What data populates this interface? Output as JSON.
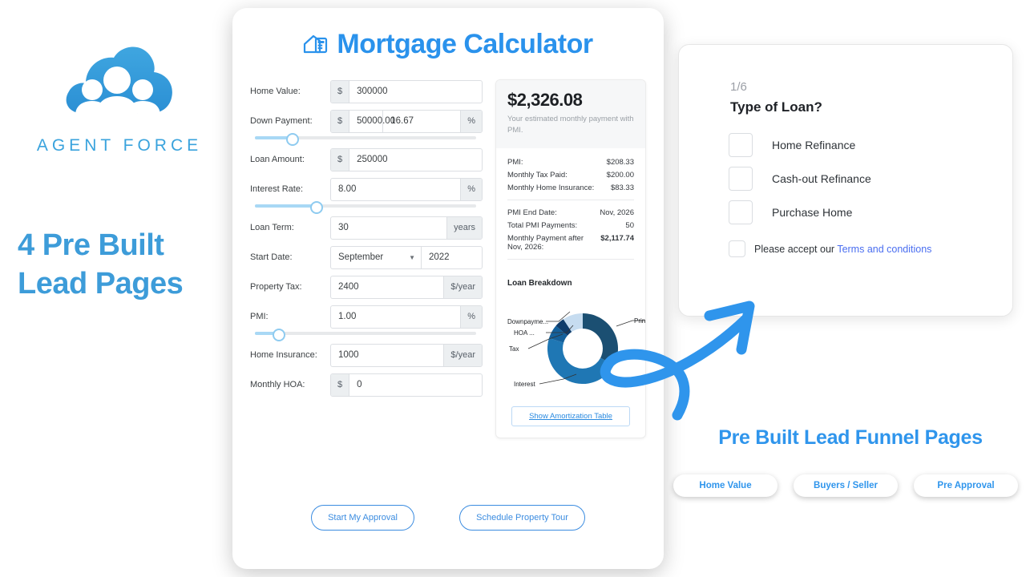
{
  "brand": {
    "logo_icon": "cloud-people-logo",
    "wordmark": "AGENT FORCE",
    "headline_line1": "4 Pre Built",
    "headline_line2": "Lead Pages",
    "accent": "#3d9cd9"
  },
  "calculator": {
    "title": "Mortgage Calculator",
    "title_icon": "house-calculator-icon",
    "fields": [
      {
        "label": "Home Value:",
        "prefix": "$",
        "value": "300000",
        "suffix": "",
        "name": "home-value"
      },
      {
        "label": "Down Payment:",
        "prefix": "$",
        "value": "50000.00",
        "value2": "16.67",
        "suffix": "%",
        "name": "down-payment"
      },
      {
        "label": "Loan Amount:",
        "prefix": "$",
        "value": "250000",
        "suffix": "",
        "name": "loan-amount"
      },
      {
        "label": "Interest Rate:",
        "prefix": "",
        "value": "8.00",
        "suffix": "%",
        "name": "interest-rate"
      },
      {
        "label": "Loan Term:",
        "prefix": "",
        "value": "30",
        "suffix": "years",
        "name": "loan-term"
      },
      {
        "label": "Start Date:",
        "prefix": "",
        "value": "September",
        "value2": "2022",
        "suffix": "",
        "name": "start-date"
      },
      {
        "label": "Property Tax:",
        "prefix": "",
        "value": "2400",
        "suffix": "$/year",
        "name": "property-tax"
      },
      {
        "label": "PMI:",
        "prefix": "",
        "value": "1.00",
        "suffix": "%",
        "name": "pmi"
      },
      {
        "label": "Home Insurance:",
        "prefix": "",
        "value": "1000",
        "suffix": "$/year",
        "name": "home-insurance"
      },
      {
        "label": "Monthly HOA:",
        "prefix": "$",
        "value": "0",
        "suffix": "",
        "name": "monthly-hoa"
      }
    ],
    "sliders": {
      "down_payment_pct": 17,
      "interest_rate_pct": 28,
      "pmi_pct": 11
    },
    "results": {
      "amount": "$2,326.08",
      "caption": "Your estimated monthly payment with PMI.",
      "rows_top": [
        {
          "k": "PMI:",
          "v": "$208.33"
        },
        {
          "k": "Monthly Tax Paid:",
          "v": "$200.00"
        },
        {
          "k": "Monthly Home Insurance:",
          "v": "$83.33"
        }
      ],
      "rows_bottom": [
        {
          "k": "PMI End Date:",
          "v": "Nov, 2026",
          "bold": false
        },
        {
          "k": "Total PMI Payments:",
          "v": "50",
          "bold": false
        },
        {
          "k": "Monthly Payment after Nov, 2026:",
          "v": "$2,117.74",
          "bold": true
        }
      ],
      "breakdown_title": "Loan Breakdown",
      "amortization_label": "Show Amortization Table"
    },
    "actions": {
      "start_approval": "Start My Approval",
      "schedule_tour": "Schedule Property Tour"
    }
  },
  "chart_data": {
    "type": "pie",
    "title": "Loan Breakdown",
    "labels": [
      "Principal",
      "Interest",
      "Tax",
      "HOA",
      "Downpayment"
    ],
    "tick_labels": [
      "Prin...",
      "Interest",
      "Tax",
      "HOA ...",
      "Downpayme..."
    ],
    "values": [
      30,
      44,
      8,
      5,
      13
    ],
    "colors": [
      "#1b4f72",
      "#1f77b4",
      "#14609b",
      "#0f3c6b",
      "#c6dcf0"
    ],
    "legend": "callout-labels",
    "donut": true
  },
  "lead_form": {
    "step": "1/6",
    "question": "Type of Loan?",
    "options": [
      {
        "label": "Home Refinance",
        "checked": false
      },
      {
        "label": "Cash-out Refinance",
        "checked": false
      },
      {
        "label": "Purchase Home",
        "checked": false
      }
    ],
    "terms_prefix": "Please accept our",
    "terms_link": "Terms and conditions",
    "terms_checked": false
  },
  "funnel": {
    "title": "Pre Built Lead Funnel Pages",
    "buttons": [
      "Home Value",
      "Buyers / Seller",
      "Pre Approval"
    ]
  },
  "arrow": {
    "icon": "curved-arrow-icon",
    "color": "#2f95ec"
  }
}
